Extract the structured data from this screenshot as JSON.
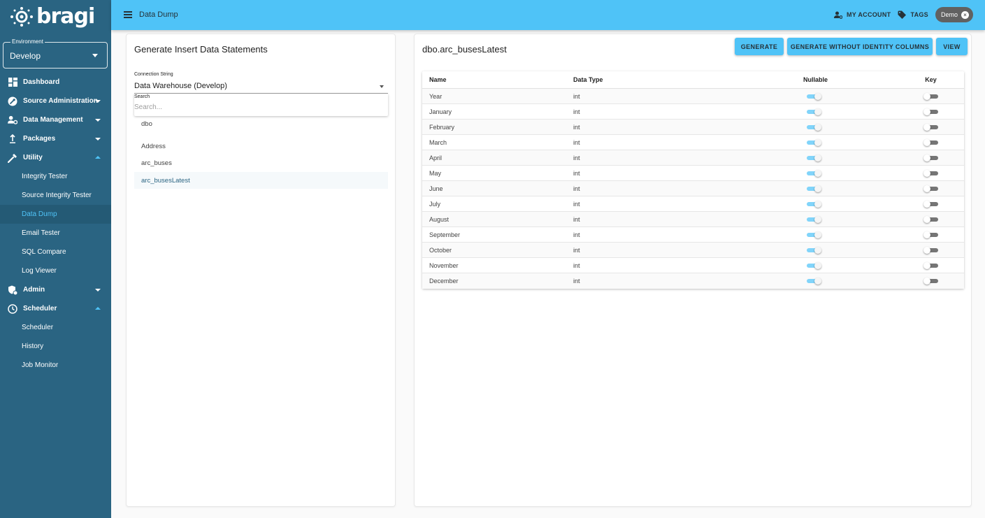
{
  "app": {
    "brand": "bragi"
  },
  "environment": {
    "label": "Environment",
    "value": "Develop"
  },
  "nav": {
    "dashboard": "Dashboard",
    "source_administration": "Source Administration",
    "data_management": "Data Management",
    "packages": "Packages",
    "utility": "Utility",
    "utility_children": [
      "Integrity Tester",
      "Source Integrity Tester",
      "Data Dump",
      "Email Tester",
      "SQL Compare",
      "Log Viewer"
    ],
    "admin": "Admin",
    "scheduler": "Scheduler",
    "scheduler_children": [
      "Scheduler",
      "History",
      "Job Monitor"
    ]
  },
  "topbar": {
    "title": "Data Dump",
    "my_account": "MY ACCOUNT",
    "tags": "TAGS",
    "chip": "Demo"
  },
  "left_panel": {
    "title": "Generate Insert Data Statements",
    "connection_label": "Connection String",
    "connection_value": "Data Warehouse (Develop)",
    "search_label": "Search",
    "search_placeholder": "Search...",
    "tree": [
      "dbo",
      "Address",
      "arc_buses",
      "arc_busesLatest"
    ]
  },
  "right_panel": {
    "title": "dbo.arc_busesLatest",
    "buttons": {
      "generate": "GENERATE",
      "generate_no_identity": "GENERATE WITHOUT IDENTITY COLUMNS",
      "view": "VIEW"
    },
    "columns": [
      "Name",
      "Data Type",
      "Nullable",
      "Key"
    ],
    "rows": [
      {
        "name": "Year",
        "type": "int",
        "nullable": true,
        "key": false
      },
      {
        "name": "January",
        "type": "int",
        "nullable": true,
        "key": false
      },
      {
        "name": "February",
        "type": "int",
        "nullable": true,
        "key": false
      },
      {
        "name": "March",
        "type": "int",
        "nullable": true,
        "key": false
      },
      {
        "name": "April",
        "type": "int",
        "nullable": true,
        "key": false
      },
      {
        "name": "May",
        "type": "int",
        "nullable": true,
        "key": false
      },
      {
        "name": "June",
        "type": "int",
        "nullable": true,
        "key": false
      },
      {
        "name": "July",
        "type": "int",
        "nullable": true,
        "key": false
      },
      {
        "name": "August",
        "type": "int",
        "nullable": true,
        "key": false
      },
      {
        "name": "September",
        "type": "int",
        "nullable": true,
        "key": false
      },
      {
        "name": "October",
        "type": "int",
        "nullable": true,
        "key": false
      },
      {
        "name": "November",
        "type": "int",
        "nullable": true,
        "key": false
      },
      {
        "name": "December",
        "type": "int",
        "nullable": true,
        "key": false
      }
    ]
  },
  "colors": {
    "sidebar": "#2a6482",
    "accent": "#4fc3f7",
    "chip": "#616161"
  }
}
